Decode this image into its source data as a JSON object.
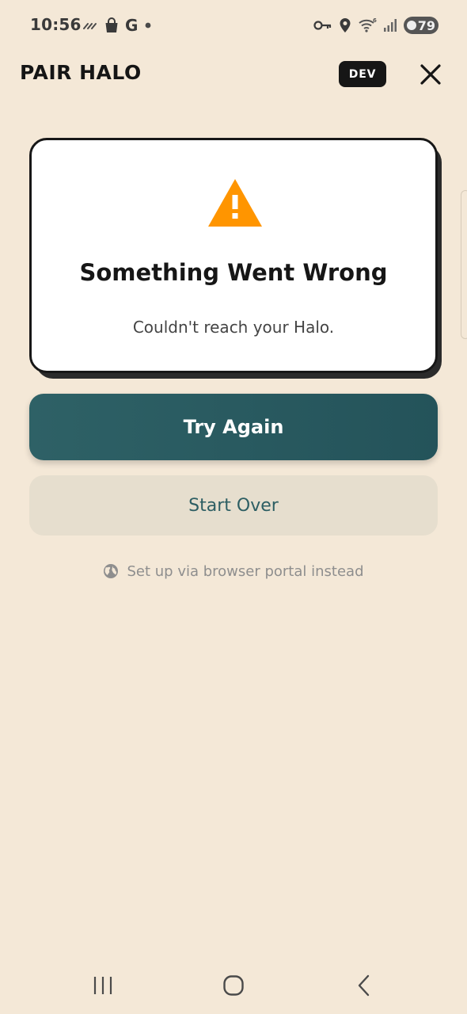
{
  "status_bar": {
    "time": "10:56",
    "battery_level": "79",
    "left_icons": [
      "weather-icon",
      "shopping-bag-icon",
      "google-icon",
      "dot-icon"
    ],
    "right_icons": [
      "vpn-key-icon",
      "location-icon",
      "wifi-icon",
      "signal-icon",
      "battery-icon"
    ],
    "google_letter": "G"
  },
  "header": {
    "title": "PAIR HALO",
    "badge": "DEV",
    "close_icon": "close-icon"
  },
  "error_card": {
    "icon": "warning-icon",
    "icon_color": "#ff9500",
    "title": "Something Went Wrong",
    "message": "Couldn't reach your Halo."
  },
  "actions": {
    "primary_label": "Try Again",
    "primary_color": "#2a5b60",
    "secondary_label": "Start Over",
    "link_label": "Set up via browser portal instead",
    "link_icon": "globe-icon"
  },
  "nav_bar": {
    "buttons": [
      "recent-apps-icon",
      "home-icon",
      "back-icon"
    ]
  }
}
